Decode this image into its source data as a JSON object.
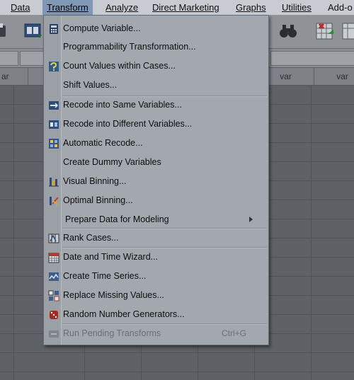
{
  "menubar": {
    "items": [
      {
        "label": "Data",
        "active": false
      },
      {
        "label": "Transform",
        "active": true
      },
      {
        "label": "Analyze",
        "active": false
      },
      {
        "label": "Direct Marketing",
        "active": false
      },
      {
        "label": "Graphs",
        "active": false
      },
      {
        "label": "Utilities",
        "active": false
      },
      {
        "label": "Add-o",
        "active": false
      }
    ]
  },
  "grid": {
    "columns": [
      "ar",
      "",
      "",
      "",
      "",
      "var",
      "var"
    ]
  },
  "menu": {
    "items": [
      {
        "label": "Compute Variable...",
        "icon": "calculator-icon"
      },
      {
        "label": "Programmability Transformation...",
        "icon": ""
      },
      {
        "label": "Count Values within Cases...",
        "icon": "count-values-icon"
      },
      {
        "label": "Shift Values...",
        "icon": ""
      },
      {
        "label": "Recode into Same Variables...",
        "icon": "recode-same-icon"
      },
      {
        "label": "Recode into Different Variables...",
        "icon": "recode-different-icon"
      },
      {
        "label": "Automatic Recode...",
        "icon": "automatic-recode-icon"
      },
      {
        "label": "Create Dummy Variables",
        "icon": ""
      },
      {
        "label": "Visual Binning...",
        "icon": "visual-binning-icon"
      },
      {
        "label": "Optimal Binning...",
        "icon": "optimal-binning-icon"
      },
      {
        "label": "Prepare Data for Modeling",
        "icon": "",
        "submenu": true
      },
      {
        "label": "Rank Cases...",
        "icon": "rank-cases-icon"
      },
      {
        "label": "Date and Time Wizard...",
        "icon": "calendar-icon"
      },
      {
        "label": "Create Time Series...",
        "icon": "time-series-icon"
      },
      {
        "label": "Replace Missing Values...",
        "icon": "replace-missing-icon"
      },
      {
        "label": "Random Number Generators...",
        "icon": "dice-icon"
      },
      {
        "label": "Run Pending Transforms",
        "icon": "run-pending-icon",
        "shortcut": "Ctrl+G",
        "disabled": true
      }
    ]
  }
}
